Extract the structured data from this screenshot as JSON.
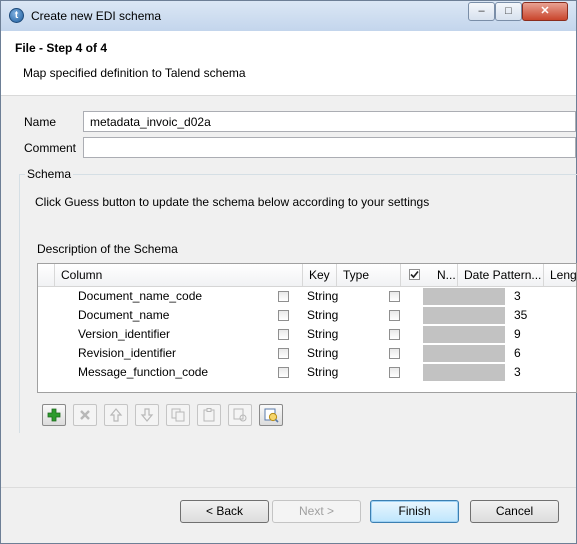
{
  "window": {
    "title": "Create new EDI schema",
    "controls": {
      "minimize": "–",
      "maximize": "□",
      "close": "✕"
    }
  },
  "header": {
    "step_title": "File - Step 4 of 4",
    "description": "Map specified definition to Talend schema"
  },
  "form": {
    "name_label": "Name",
    "name_value": "metadata_invoic_d02a",
    "comment_label": "Comment",
    "comment_value": ""
  },
  "schema_group": {
    "label": "Schema",
    "hint": "Click Guess button to update the schema below according to your settings",
    "table_caption": "Description of the Schema"
  },
  "table": {
    "columns": [
      "Column",
      "Key",
      "Type",
      "N...",
      "Date Pattern...",
      "Length"
    ],
    "nullable_header_checked": true,
    "rows": [
      {
        "column": "Document_name_code",
        "key": false,
        "type": "String",
        "nullable": false,
        "length": "3"
      },
      {
        "column": "Document_name",
        "key": false,
        "type": "String",
        "nullable": false,
        "length": "35"
      },
      {
        "column": "Version_identifier",
        "key": false,
        "type": "String",
        "nullable": false,
        "length": "9"
      },
      {
        "column": "Revision_identifier",
        "key": false,
        "type": "String",
        "nullable": false,
        "length": "6"
      },
      {
        "column": "Message_function_code",
        "key": false,
        "type": "String",
        "nullable": false,
        "length": "3"
      }
    ]
  },
  "toolbar": {
    "icons": [
      "add-icon",
      "remove-icon",
      "move-up-icon",
      "move-down-icon",
      "copy-icon",
      "paste-icon",
      "import-icon",
      "guess-icon"
    ]
  },
  "buttons": {
    "back": "< Back",
    "next": "Next >",
    "finish": "Finish",
    "cancel": "Cancel"
  },
  "colors": {
    "accent": "#3c7fb1",
    "add_green": "#2e9b2e"
  }
}
